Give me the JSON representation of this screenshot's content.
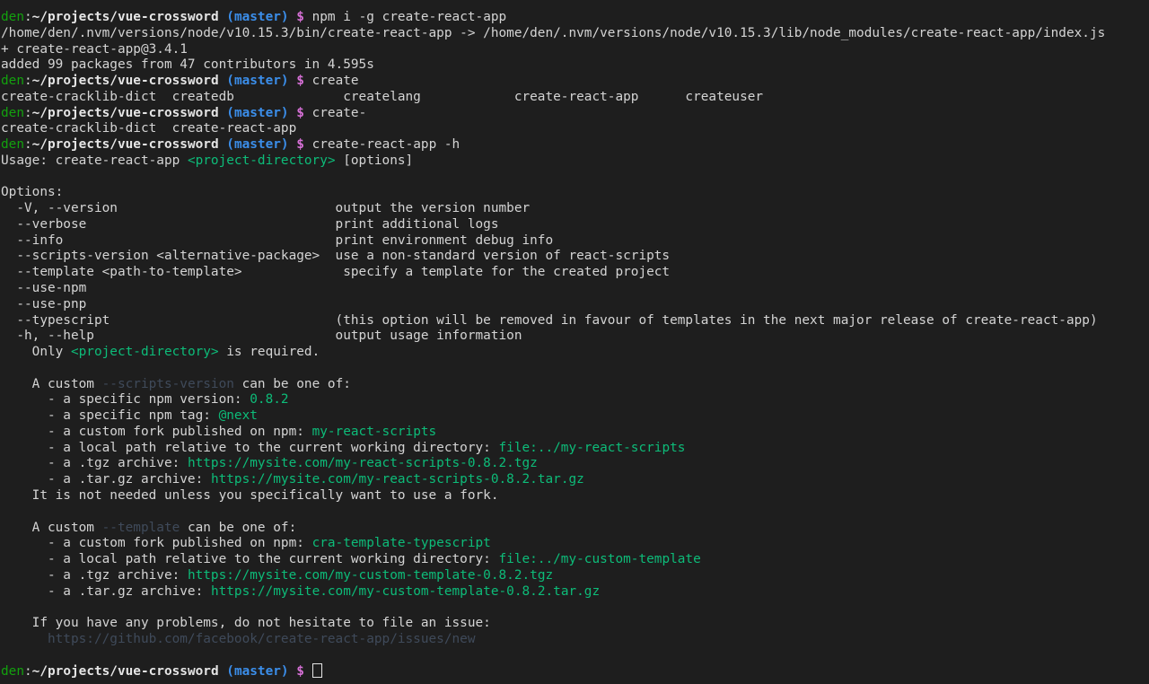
{
  "prompt": {
    "user": "den",
    "sep": ":",
    "path": "~/projects/vue-crossword",
    "branch": "(master)",
    "symbol": "$"
  },
  "lines": [
    {
      "type": "prompt",
      "cmd": "npm i -g create-react-app"
    },
    {
      "type": "text",
      "segs": [
        {
          "t": "/home/den/.nvm/versions/node/v10.15.3/bin/create-react-app -> /home/den/.nvm/versions/node/v10.15.3/lib/node_modules/create-react-app/index.js"
        }
      ]
    },
    {
      "type": "text",
      "segs": [
        {
          "t": "+ create-react-app@3.4.1"
        }
      ]
    },
    {
      "type": "text",
      "segs": [
        {
          "t": "added 99 packages from 47 contributors in 4.595s"
        }
      ]
    },
    {
      "type": "prompt",
      "cmd": "create"
    },
    {
      "type": "text",
      "segs": [
        {
          "t": "create-cracklib-dict  createdb              createlang            create-react-app      createuser"
        }
      ]
    },
    {
      "type": "prompt",
      "cmd": "create-"
    },
    {
      "type": "text",
      "segs": [
        {
          "t": "create-cracklib-dict  create-react-app"
        }
      ]
    },
    {
      "type": "prompt",
      "cmd": "create-react-app -h"
    },
    {
      "type": "text",
      "segs": [
        {
          "t": "Usage: create-react-app "
        },
        {
          "t": "<project-directory>",
          "c": "green"
        },
        {
          "t": " [options]"
        }
      ]
    },
    {
      "type": "text",
      "segs": [
        {
          "t": ""
        }
      ]
    },
    {
      "type": "text",
      "segs": [
        {
          "t": "Options:"
        }
      ]
    },
    {
      "type": "text",
      "segs": [
        {
          "t": "  -V, --version                            output the version number"
        }
      ]
    },
    {
      "type": "text",
      "segs": [
        {
          "t": "  --verbose                                print additional logs"
        }
      ]
    },
    {
      "type": "text",
      "segs": [
        {
          "t": "  --info                                   print environment debug info"
        }
      ]
    },
    {
      "type": "text",
      "segs": [
        {
          "t": "  --scripts-version <alternative-package>  use a non-standard version of react-scripts"
        }
      ]
    },
    {
      "type": "text",
      "segs": [
        {
          "t": "  --template <path-to-template>             specify a template for the created project"
        }
      ]
    },
    {
      "type": "text",
      "segs": [
        {
          "t": "  --use-npm"
        }
      ]
    },
    {
      "type": "text",
      "segs": [
        {
          "t": "  --use-pnp"
        }
      ]
    },
    {
      "type": "text",
      "segs": [
        {
          "t": "  --typescript                             (this option will be removed in favour of templates in the next major release of create-react-app)"
        }
      ]
    },
    {
      "type": "text",
      "segs": [
        {
          "t": "  -h, --help                               output usage information"
        }
      ]
    },
    {
      "type": "text",
      "segs": [
        {
          "t": "    Only "
        },
        {
          "t": "<project-directory>",
          "c": "green"
        },
        {
          "t": " is required."
        }
      ]
    },
    {
      "type": "text",
      "segs": [
        {
          "t": ""
        }
      ]
    },
    {
      "type": "text",
      "segs": [
        {
          "t": "    A custom "
        },
        {
          "t": "--scripts-version",
          "c": "dim"
        },
        {
          "t": " can be one of:"
        }
      ]
    },
    {
      "type": "text",
      "segs": [
        {
          "t": "      - a specific npm version: "
        },
        {
          "t": "0.8.2",
          "c": "green"
        }
      ]
    },
    {
      "type": "text",
      "segs": [
        {
          "t": "      - a specific npm tag: "
        },
        {
          "t": "@next",
          "c": "green"
        }
      ]
    },
    {
      "type": "text",
      "segs": [
        {
          "t": "      - a custom fork published on npm: "
        },
        {
          "t": "my-react-scripts",
          "c": "green"
        }
      ]
    },
    {
      "type": "text",
      "segs": [
        {
          "t": "      - a local path relative to the current working directory: "
        },
        {
          "t": "file:../my-react-scripts",
          "c": "green"
        }
      ]
    },
    {
      "type": "text",
      "segs": [
        {
          "t": "      - a .tgz archive: "
        },
        {
          "t": "https://mysite.com/my-react-scripts-0.8.2.tgz",
          "c": "green"
        }
      ]
    },
    {
      "type": "text",
      "segs": [
        {
          "t": "      - a .tar.gz archive: "
        },
        {
          "t": "https://mysite.com/my-react-scripts-0.8.2.tar.gz",
          "c": "green"
        }
      ]
    },
    {
      "type": "text",
      "segs": [
        {
          "t": "    It is not needed unless you specifically want to use a fork."
        }
      ]
    },
    {
      "type": "text",
      "segs": [
        {
          "t": ""
        }
      ]
    },
    {
      "type": "text",
      "segs": [
        {
          "t": "    A custom "
        },
        {
          "t": "--template",
          "c": "dim"
        },
        {
          "t": " can be one of:"
        }
      ]
    },
    {
      "type": "text",
      "segs": [
        {
          "t": "      - a custom fork published on npm: "
        },
        {
          "t": "cra-template-typescript",
          "c": "green"
        }
      ]
    },
    {
      "type": "text",
      "segs": [
        {
          "t": "      - a local path relative to the current working directory: "
        },
        {
          "t": "file:../my-custom-template",
          "c": "green"
        }
      ]
    },
    {
      "type": "text",
      "segs": [
        {
          "t": "      - a .tgz archive: "
        },
        {
          "t": "https://mysite.com/my-custom-template-0.8.2.tgz",
          "c": "green"
        }
      ]
    },
    {
      "type": "text",
      "segs": [
        {
          "t": "      - a .tar.gz archive: "
        },
        {
          "t": "https://mysite.com/my-custom-template-0.8.2.tar.gz",
          "c": "green"
        }
      ]
    },
    {
      "type": "text",
      "segs": [
        {
          "t": ""
        }
      ]
    },
    {
      "type": "text",
      "segs": [
        {
          "t": "    If you have any problems, do not hesitate to file an issue:"
        }
      ]
    },
    {
      "type": "text",
      "segs": [
        {
          "t": "      "
        },
        {
          "t": "https://github.com/facebook/create-react-app/issues/new",
          "c": "dim"
        }
      ]
    },
    {
      "type": "text",
      "segs": [
        {
          "t": ""
        }
      ]
    },
    {
      "type": "prompt",
      "cmd": "",
      "cursor": true
    }
  ],
  "colors": {
    "background": "#1e1e1e",
    "foreground": "#d4d4d4",
    "prompt_user": "#13a10e",
    "prompt_branch": "#3b8eea",
    "prompt_symbol": "#d670d6",
    "highlight_green": "#0dbc79",
    "dim": "#3f4a5a"
  }
}
